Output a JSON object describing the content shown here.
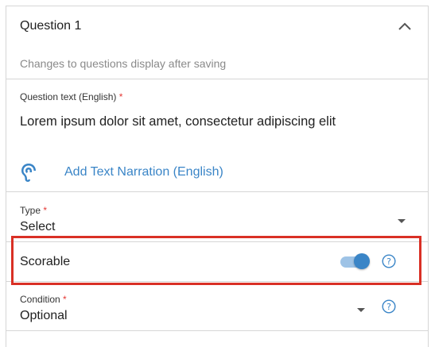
{
  "header": {
    "title": "Question 1",
    "hint": "Changes to questions display after saving"
  },
  "question_text": {
    "label": "Question text (English)",
    "required_mark": "*",
    "value": "Lorem ipsum dolor sit amet, consectetur adipiscing elit"
  },
  "narration": {
    "label": "Add Text Narration (English)"
  },
  "type_field": {
    "label": "Type",
    "required_mark": "*",
    "value": "Select"
  },
  "scorable": {
    "label": "Scorable",
    "enabled": true
  },
  "condition_field": {
    "label": "Condition",
    "required_mark": "*",
    "value": "Optional"
  },
  "colors": {
    "accent": "#3a85c7",
    "highlight": "#d93025",
    "required": "#e53935"
  }
}
